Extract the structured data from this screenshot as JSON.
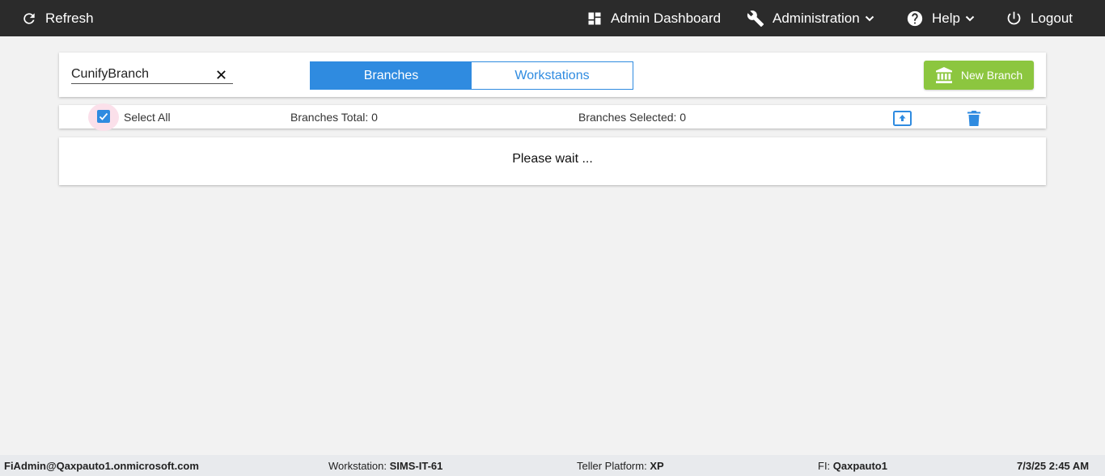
{
  "topbar": {
    "refresh_label": "Refresh",
    "dashboard_label": "Admin Dashboard",
    "administration_label": "Administration",
    "help_label": "Help",
    "logout_label": "Logout"
  },
  "search": {
    "value": "CunifyBranch"
  },
  "tabs": [
    {
      "label": "Branches",
      "active": true
    },
    {
      "label": "Workstations",
      "active": false
    }
  ],
  "new_branch_label": "New Branch",
  "selection": {
    "select_all_label": "Select All",
    "select_all_checked": true,
    "total_label": "Branches Total: 0",
    "selected_label": "Branches Selected: 0"
  },
  "status_message": "Please wait ...",
  "footer": {
    "user": "FiAdmin@Qaxpauto1.onmicrosoft.com",
    "workstation_label": "Workstation:",
    "workstation_value": "SIMS-IT-61",
    "platform_label": "Teller Platform:",
    "platform_value": "XP",
    "fi_label": "FI:",
    "fi_value": "Qaxpauto1",
    "datetime": "7/3/25 2:45 AM"
  },
  "colors": {
    "topbar": "#2b2b2b",
    "accent": "#2f8be0",
    "new_branch": "#8cc63f",
    "background": "#f2f2f2"
  },
  "icons": [
    "refresh-icon",
    "dashboard-icon",
    "wrench-icon",
    "help-icon",
    "power-icon",
    "close-icon",
    "bank-icon",
    "checkmark-icon",
    "upload-icon",
    "trash-icon",
    "chevron-down-icon"
  ]
}
